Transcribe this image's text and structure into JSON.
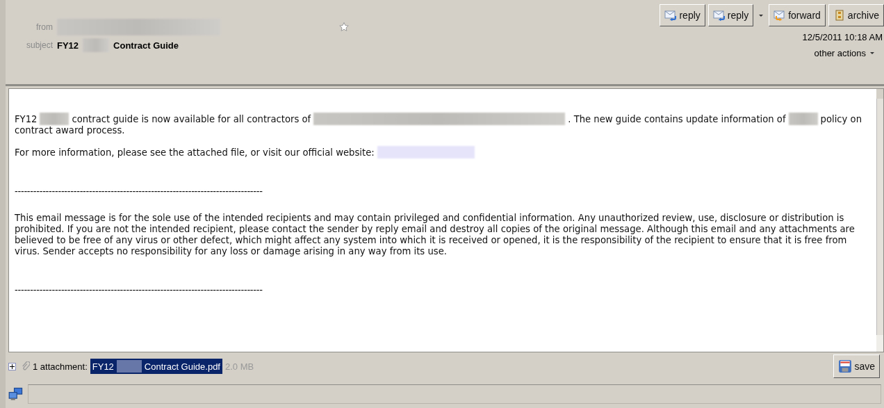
{
  "header": {
    "from_label": "from",
    "subject_label": "subject",
    "subject": [
      {
        "kind": "text",
        "text": "FY12"
      },
      {
        "kind": "redacted"
      },
      {
        "kind": "text",
        "text": "Contract Guide"
      }
    ],
    "starred": false,
    "date": "12/5/2011 10:18 AM",
    "other_actions": "other actions"
  },
  "toolbar": [
    {
      "kind": "reply",
      "label": "reply"
    },
    {
      "kind": "reply",
      "label": "reply"
    },
    {
      "kind": "caret"
    },
    {
      "kind": "forward",
      "label": "forward"
    },
    {
      "kind": "archive",
      "label": "archive"
    }
  ],
  "body": [
    {
      "kind": "para",
      "segments": [
        {
          "kind": "text",
          "text": "FY12"
        },
        {
          "kind": "redacted-short"
        },
        {
          "kind": "text",
          "text": "contract guide is now available for all contractors of"
        },
        {
          "kind": "redacted-long"
        },
        {
          "kind": "text",
          "text": ". The new guide contains update information of"
        },
        {
          "kind": "redacted-short"
        },
        {
          "kind": "text",
          "text": "policy on contract award process."
        }
      ]
    },
    {
      "kind": "para",
      "segments": [
        {
          "kind": "text",
          "text": "For more information, please see the attached file, or visit our official website:"
        },
        {
          "kind": "link-redacted"
        }
      ]
    },
    {
      "kind": "rule",
      "text": "--------------------------------------------------------------------------------"
    },
    {
      "kind": "para",
      "segments": [
        {
          "kind": "text",
          "text": "This email message is for the sole use of the intended recipients and may contain privileged and confidential information. Any unauthorized review, use, disclosure or distribution is prohibited.  If you are not the intended recipient, please contact the sender by reply email and destroy all copies of the original message.  Although this email and any attachments are believed to be free of any virus or other defect, which might affect any system into which it is received or opened, it is the responsibility of the recipient to ensure that it is free from virus. Sender accepts no responsibility for any loss or damage arising in any way from its use."
        }
      ]
    },
    {
      "kind": "rule",
      "text": "--------------------------------------------------------------------------------"
    }
  ],
  "attachments": {
    "expanded": false,
    "label": "1 attachment:",
    "file": [
      {
        "kind": "text",
        "text": "FY12"
      },
      {
        "kind": "redacted"
      },
      {
        "kind": "text",
        "text": "Contract Guide.pdf"
      }
    ],
    "selected": true,
    "size": "2.0 MB",
    "save": "save"
  }
}
